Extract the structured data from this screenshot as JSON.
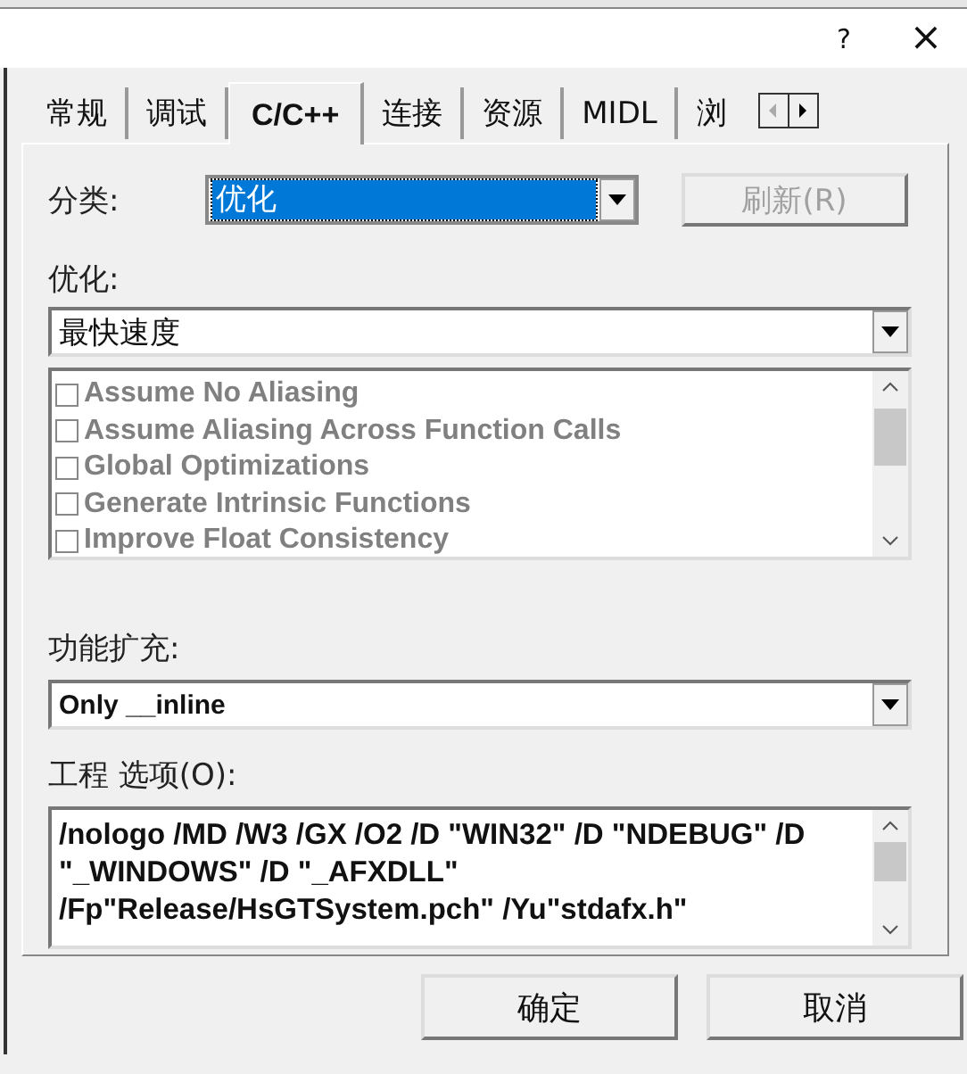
{
  "window": {
    "help_button": "?",
    "close_button": "×"
  },
  "tabs": [
    {
      "label": "常规",
      "selected": false
    },
    {
      "label": "调试",
      "selected": false
    },
    {
      "label": "C/C++",
      "selected": true
    },
    {
      "label": "连接",
      "selected": false
    },
    {
      "label": "资源",
      "selected": false
    },
    {
      "label": "MIDL",
      "selected": false
    },
    {
      "label": "浏",
      "selected": false
    }
  ],
  "category": {
    "label": "分类:",
    "value": "优化",
    "refresh_button": {
      "label": "刷新(R)",
      "disabled": true
    }
  },
  "optimization": {
    "label": "优化:",
    "value": "最快速度",
    "disabled": true,
    "options": [
      {
        "label": "Assume No Aliasing",
        "checked": false
      },
      {
        "label": "Assume Aliasing Across Function Calls",
        "checked": false
      },
      {
        "label": "Global Optimizations",
        "checked": false
      },
      {
        "label": "Generate Intrinsic Functions",
        "checked": false
      },
      {
        "label": "Improve Float Consistency",
        "checked": false
      }
    ]
  },
  "inline_expansion": {
    "label": "功能扩充:",
    "value": "Only __inline"
  },
  "project_options": {
    "label": "工程 选项(O):",
    "value": "/nologo /MD /W3 /GX /O2 /D \"WIN32\" /D \"NDEBUG\" /D \"_WINDOWS\" /D \"_AFXDLL\" /Fp\"Release/HsGTSystem.pch\" /Yu\"stdafx.h\""
  },
  "buttons": [
    "确定",
    "取消"
  ]
}
